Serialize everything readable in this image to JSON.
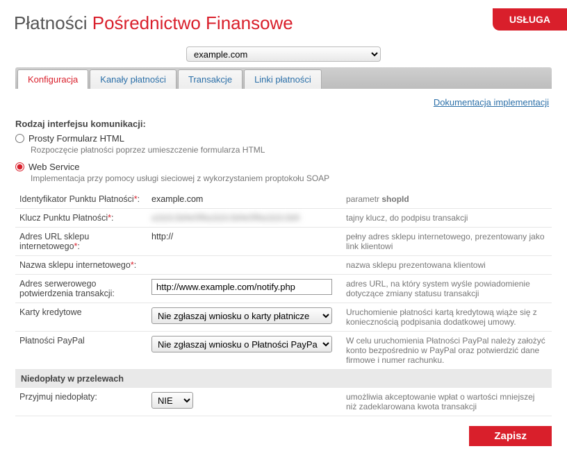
{
  "header": {
    "title_main": "Płatności",
    "title_sub": "Pośrednictwo Finansowe",
    "service_tag": "USŁUGA"
  },
  "shop_select": {
    "selected": "example.com"
  },
  "tabs": [
    {
      "label": "Konfiguracja",
      "active": true
    },
    {
      "label": "Kanały płatności",
      "active": false
    },
    {
      "label": "Transakcje",
      "active": false
    },
    {
      "label": "Linki płatności",
      "active": false
    }
  ],
  "doc_link": "Dokumentacja implementacji",
  "interface_section": {
    "label": "Rodzaj interfejsu komunikacji:",
    "options": [
      {
        "label": "Prosty Formularz HTML",
        "desc": "Rozpoczęcie płatności poprzez umieszczenie formularza HTML",
        "checked": false
      },
      {
        "label": "Web Service",
        "desc": "Implementacja przy pomocy usługi sieciowej z wykorzystaniem proptokołu SOAP",
        "checked": true
      }
    ]
  },
  "rows": {
    "shopid": {
      "label": "Identyfikator Punktu Płatności",
      "req": "*",
      "sep": ":",
      "value": "example.com",
      "hint_pre": "parametr ",
      "hint_b": "shopId"
    },
    "key": {
      "label": "Klucz Punktu Płatności",
      "req": "*",
      "sep": ":",
      "value": "a1b2c3d4e5f6a1b2c3d4e5f6a1b2c3d4",
      "hint": "tajny klucz, do podpisu transakcji"
    },
    "url": {
      "label": "Adres URL sklepu internetowego",
      "req": "*",
      "sep": ":",
      "value": "http://",
      "hint": "pełny adres sklepu internetowego, prezentowany jako link klientowi"
    },
    "name": {
      "label": "Nazwa sklepu internetowego",
      "req": "*",
      "sep": ":",
      "value": "",
      "hint": "nazwa sklepu prezentowana klientowi"
    },
    "notify": {
      "label": "Adres serwerowego potwierdzenia transakcji:",
      "value": "http://www.example.com/notify.php",
      "hint": "adres URL, na który system wyśle powiadomienie dotyczące zmiany statusu transakcji"
    },
    "cards": {
      "label": "Karty kredytowe",
      "value": "Nie zgłaszaj wniosku o karty płatnicze",
      "hint": "Uruchomienie płatności kartą kredytową wiąże się z koniecznością podpisania dodatkowej umowy."
    },
    "paypal": {
      "label": "Płatności PayPal",
      "value": "Nie zgłaszaj wniosku o Płatności PayPal",
      "hint": "W celu uruchomienia Płatności PayPal należy założyć konto bezpośrednio w PayPal oraz potwierdzić dane firmowe i numer rachunku."
    },
    "underpay_head": "Niedopłaty w przelewach",
    "underpay": {
      "label": "Przyjmuj niedopłaty:",
      "value": "NIE",
      "hint": "umożliwia akceptowanie wpłat o wartości mniejszej niż zadeklarowana kwota transakcji"
    }
  },
  "buttons": {
    "save": "Zapisz"
  }
}
